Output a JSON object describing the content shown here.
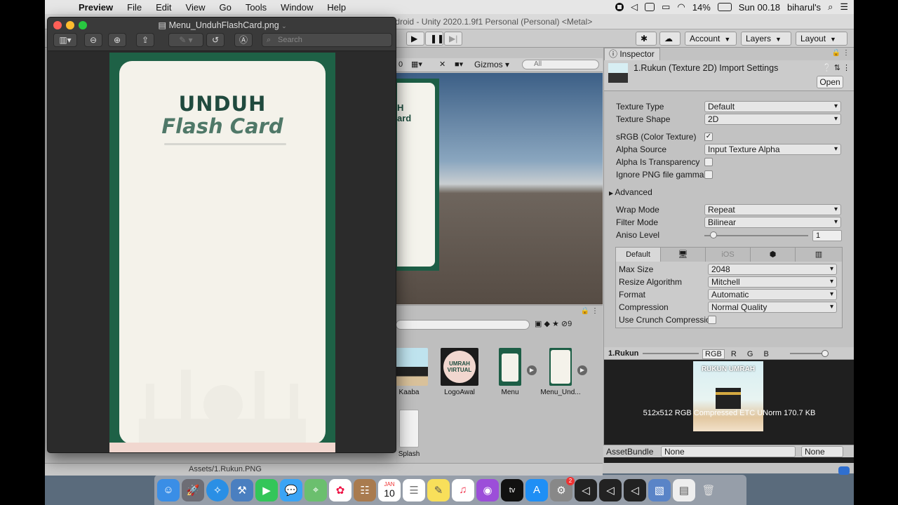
{
  "menubar": {
    "apple": "",
    "app": "Preview",
    "items": [
      "File",
      "Edit",
      "View",
      "Go",
      "Tools",
      "Window",
      "Help"
    ],
    "battery": "14%",
    "clock": "Sun 00.18",
    "user": "biharul's"
  },
  "unity": {
    "title": "ndroid - Unity 2020.1.9f1 Personal (Personal) <Metal>",
    "toolbar": {
      "account": "Account",
      "layers": "Layers",
      "layout": "Layout"
    },
    "scene": {
      "gizmos": "Gizmos",
      "search_placeholder": "All",
      "card_text_1": "H",
      "card_text_2": "ard"
    },
    "project": {
      "count": "9",
      "assets": [
        {
          "name": "Kaaba",
          "color": "#bfe3ee"
        },
        {
          "name": "LogoAwal",
          "color": "#1b1b1b"
        },
        {
          "name": "Menu",
          "color": "#1d5e46"
        },
        {
          "name": "Menu_Und...",
          "color": "#f4f2ea"
        },
        {
          "name": "Splash",
          "color": "#f2f2f2"
        }
      ],
      "logo_text": "UMRAH VIRTUAL",
      "path": "Assets/1.Rukun.PNG"
    },
    "inspector": {
      "tab": "Inspector",
      "title": "1.Rukun (Texture 2D) Import Settings",
      "open": "Open",
      "fields": [
        {
          "label": "Texture Type",
          "value": "Default"
        },
        {
          "label": "Texture Shape",
          "value": "2D"
        }
      ],
      "srgb": "sRGB (Color Texture)",
      "srgb_check": "✓",
      "alpha_source_label": "Alpha Source",
      "alpha_source": "Input Texture Alpha",
      "alpha_transparency": "Alpha Is Transparency",
      "ignore_png": "Ignore PNG file gamma",
      "advanced": "Advanced",
      "wrap_label": "Wrap Mode",
      "wrap": "Repeat",
      "filter_label": "Filter Mode",
      "filter": "Bilinear",
      "aniso_label": "Aniso Level",
      "aniso": "1",
      "platform_default": "Default",
      "platform_ios": "iOS",
      "platform": [
        {
          "label": "Max Size",
          "value": "2048"
        },
        {
          "label": "Resize Algorithm",
          "value": "Mitchell"
        },
        {
          "label": "Format",
          "value": "Automatic"
        },
        {
          "label": "Compression",
          "value": "Normal Quality"
        }
      ],
      "crunch": "Use Crunch Compression",
      "preview_name": "1.Rukun",
      "channels": [
        "RGB",
        "R",
        "G",
        "B"
      ],
      "preview_title": "RUKUN UMRAH",
      "preview_info": "512x512  RGB Compressed ETC UNorm  170.7 KB",
      "assetbundle_label": "AssetBundle",
      "assetbundle": "None",
      "assetvariant": "None"
    }
  },
  "preview_window": {
    "filename": "Menu_UnduhFlashCard.png",
    "search_placeholder": "Search",
    "card_title_1": "UNDUH",
    "card_title_2": "Flash Card"
  },
  "dock": {
    "apps": [
      "finder-icon",
      "launchpad-icon",
      "safari-icon",
      "xcode-icon",
      "facetime-icon",
      "messages-icon",
      "maps-icon",
      "photos-icon",
      "contacts-icon",
      "calendar-icon",
      "reminders-icon",
      "notes-icon",
      "music-icon",
      "podcasts-icon",
      "tv-icon",
      "appstore-icon",
      "settings-icon",
      "unity-hub-icon",
      "unity-icon",
      "unity-icon-2",
      "preview-icon",
      "textedit-icon",
      "trash-icon"
    ],
    "calendar_month": "JAN",
    "calendar_day": "10",
    "tv_label": "tv",
    "settings_badge": "2"
  }
}
